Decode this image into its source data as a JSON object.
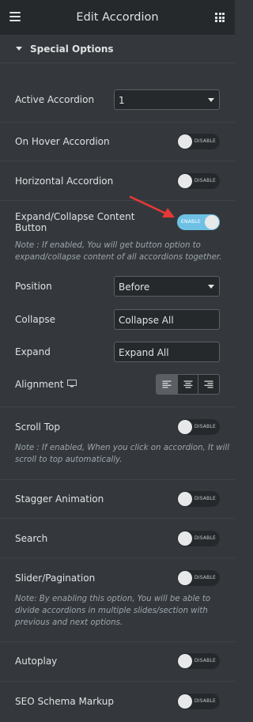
{
  "header": {
    "title": "Edit Accordion",
    "menu_icon": "hamburger-menu-icon",
    "apps_icon": "grid-apps-icon"
  },
  "section": {
    "label": "Special Options"
  },
  "active_accordion": {
    "label": "Active Accordion",
    "value": "1"
  },
  "on_hover": {
    "label": "On Hover Accordion",
    "toggle": "DISABLE",
    "enabled": false
  },
  "horizontal": {
    "label": "Horizontal Accordion",
    "toggle": "DISABLE",
    "enabled": false
  },
  "expand_collapse": {
    "label_line1": "Expand/Collapse Content",
    "label_line2": "Button",
    "toggle": "ENABLE",
    "enabled": true,
    "note_line1": "Note : If enabled, You will get button option to",
    "note_line2": "expand/collapse content of all accordions together."
  },
  "position": {
    "label": "Position",
    "value": "Before"
  },
  "collapse": {
    "label": "Collapse",
    "value": "Collapse All"
  },
  "expand": {
    "label": "Expand",
    "value": "Expand All"
  },
  "alignment": {
    "label": "Alignment",
    "options": [
      "align-left-icon",
      "align-center-icon",
      "align-right-icon"
    ],
    "selected": "align-left-icon"
  },
  "scroll_top": {
    "label": "Scroll Top",
    "toggle": "DISABLE",
    "enabled": false,
    "note_line1": "Note : If enabled, When you click on accordion, It will",
    "note_line2": "scroll to top automatically."
  },
  "stagger": {
    "label": "Stagger Animation",
    "toggle": "DISABLE",
    "enabled": false
  },
  "search": {
    "label": "Search",
    "toggle": "DISABLE",
    "enabled": false
  },
  "slider": {
    "label": "Slider/Pagination",
    "toggle": "DISABLE",
    "enabled": false,
    "note_line1": "Note: By enabling this option, You will be able to",
    "note_line2": "divide accordions in multiple slides/section with",
    "note_line3": "previous and next options."
  },
  "autoplay": {
    "label": "Autoplay",
    "toggle": "DISABLE",
    "enabled": false
  },
  "seo": {
    "label": "SEO Schema Markup",
    "toggle": "DISABLE",
    "enabled": false
  },
  "colors": {
    "panel_bg": "#34383c",
    "header_bg": "#26292c",
    "toggle_on": "#6ec1e4",
    "arrow": "#e53935"
  }
}
